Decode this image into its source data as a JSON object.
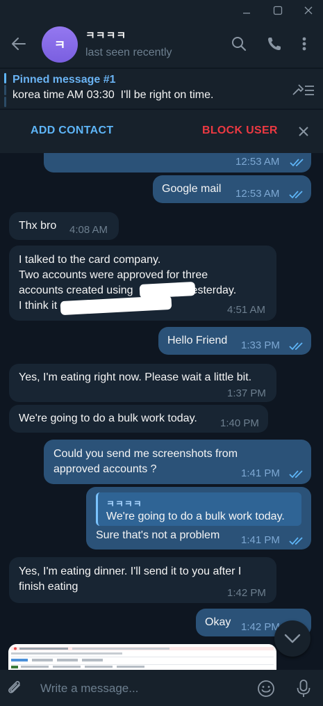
{
  "titlebar": {
    "minimize_icon": "minimize-icon",
    "maximize_icon": "maximize-icon",
    "close_icon": "close-icon"
  },
  "header": {
    "avatar_letter": "ㅋ",
    "name": "ㅋㅋㅋㅋ",
    "status": "last seen recently",
    "avatar_color": "#8a6ef0"
  },
  "pinned": {
    "title": "Pinned message #1",
    "text": "korea time AM 03:30  I'll be right on time."
  },
  "actions": {
    "add_contact": "ADD CONTACT",
    "block_user": "BLOCK USER"
  },
  "messages": [
    {
      "id": "m0",
      "side": "out",
      "text": "",
      "time": "12:53 AM",
      "read": true
    },
    {
      "id": "m1",
      "side": "out",
      "text": "Google mail",
      "time": "12:53 AM",
      "read": true
    },
    {
      "id": "m2",
      "side": "in",
      "text": "Thx bro",
      "time": "4:08 AM"
    },
    {
      "id": "m3",
      "side": "in",
      "lines": [
        "I talked to the card company.",
        "Two accounts were approved for three",
        "accounts created using",
        "I think it"
      ],
      "line3_suffix": "yesterday.",
      "time": "4:51 AM"
    },
    {
      "id": "m4",
      "side": "out",
      "text": "Hello Friend",
      "time": "1:33 PM",
      "read": true
    },
    {
      "id": "m5",
      "side": "in",
      "text": "Yes, I'm eating right now. Please wait a little bit.",
      "time": "1:37 PM"
    },
    {
      "id": "m6",
      "side": "in",
      "text": "We're going to do a bulk work today.",
      "time": "1:40 PM"
    },
    {
      "id": "m7",
      "side": "out",
      "lines": [
        "Could you send me screenshots from",
        "approved accounts ?"
      ],
      "time": "1:41 PM",
      "read": true
    },
    {
      "id": "m8",
      "side": "out",
      "reply_name": "ㅋㅋㅋㅋ",
      "reply_text": "We're going to do a bulk work today.",
      "text": "Sure that's not a problem",
      "time": "1:41 PM",
      "read": true
    },
    {
      "id": "m9",
      "side": "in",
      "lines": [
        "Yes, I'm eating dinner. I'll send it to you after I",
        "finish eating"
      ],
      "time": "1:42 PM"
    },
    {
      "id": "m10",
      "side": "out",
      "text": "Okay",
      "time": "1:42 PM",
      "read": true
    }
  ],
  "composer": {
    "placeholder": "Write a message..."
  },
  "colors": {
    "background": "#0e1621",
    "panel": "#17212b",
    "incoming": "#182533",
    "outgoing": "#2b5278",
    "accent": "#5eb5f7",
    "danger": "#ec3942"
  }
}
